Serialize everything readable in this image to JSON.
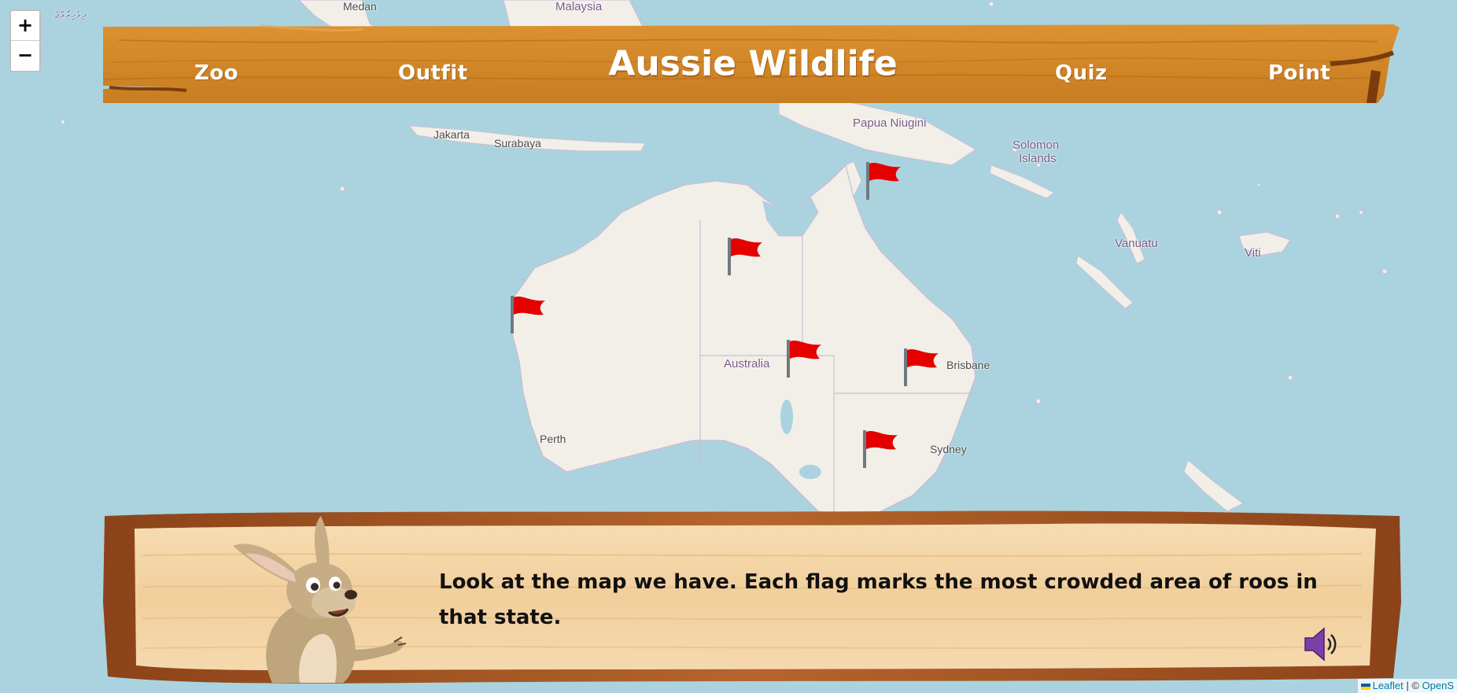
{
  "header": {
    "title": "Aussie Wildlife",
    "nav": {
      "zoo": "Zoo",
      "outfit": "Outfit",
      "quiz": "Quiz",
      "point": "Point"
    }
  },
  "zoom": {
    "in": "+",
    "out": "−"
  },
  "map": {
    "labels": {
      "medan": "Medan",
      "malaysia": "Malaysia",
      "jakarta": "Jakarta",
      "surabaya": "Surabaya",
      "papua": "Papua Niugini",
      "solomon_line1": "Solomon",
      "solomon_line2": "Islands",
      "vanuatu": "Vanuatu",
      "viti": "Viti",
      "australia": "Australia",
      "brisbane": "Brisbane",
      "sydney": "Sydney",
      "perth": "Perth",
      "maldives": "ދިވެހިރާއްޖެ"
    },
    "flag_count": 6
  },
  "dialog": {
    "text": "Look at the map we have. Each flag marks the most crowded area of roos in that state."
  },
  "attribution": {
    "leaflet": "Leaflet",
    "separator": " | © ",
    "osm": "OpenS"
  },
  "icons": {
    "flag": "red-flag-icon",
    "speaker": "speaker-icon",
    "kangaroo": "kangaroo-mascot"
  },
  "colors": {
    "sea": "#aad3df",
    "land": "#f2efe9",
    "header_wood": "#d58a2c",
    "dialog_wood": "#f3d2a3",
    "dialog_frame": "#b0602a",
    "flag": "#e50000",
    "speaker": "#7b3fa8"
  }
}
